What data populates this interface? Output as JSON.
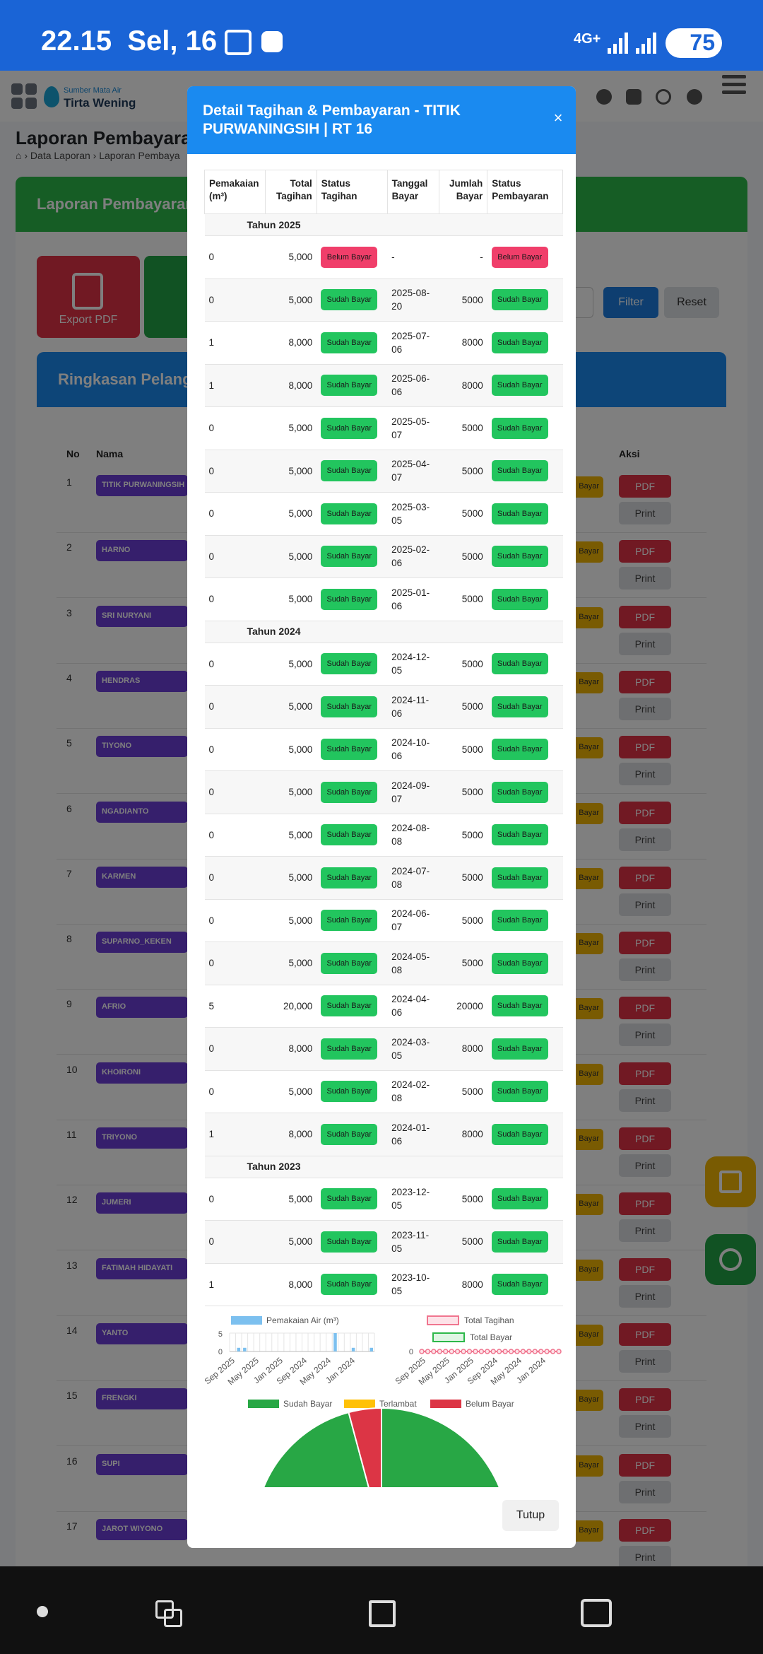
{
  "status_bar": {
    "time": "22.15",
    "date": "Sel, 16",
    "network": "4G+",
    "battery": "75"
  },
  "app": {
    "logo_small": "Sumber Mata Air",
    "logo_big": "Tirta Wening",
    "page_title": "Laporan Pembayaran",
    "breadcrumb": [
      "Data Laporan",
      "Laporan Pembaya"
    ],
    "card_title": "Laporan Pembayaran",
    "export_pdf": "Export PDF",
    "filter": "Filter",
    "reset": "Reset",
    "summary_title": "Ringkasan Pelangg",
    "table_headers": {
      "no": "No",
      "nama": "Nama",
      "aksi": "Aksi"
    },
    "badge_text": "Bayar",
    "pdf_label": "PDF",
    "print_label": "Print",
    "rows": [
      {
        "no": "1",
        "name": "TITIK PURWANINGSIH"
      },
      {
        "no": "2",
        "name": "HARNO"
      },
      {
        "no": "3",
        "name": "SRI NURYANI"
      },
      {
        "no": "4",
        "name": "HENDRAS"
      },
      {
        "no": "5",
        "name": "TIYONO"
      },
      {
        "no": "6",
        "name": "NGADIANTO"
      },
      {
        "no": "7",
        "name": "KARMEN"
      },
      {
        "no": "8",
        "name": "SUPARNO_KEKEN"
      },
      {
        "no": "9",
        "name": "AFRIO"
      },
      {
        "no": "10",
        "name": "KHOIRONI"
      },
      {
        "no": "11",
        "name": "TRIYONO"
      },
      {
        "no": "12",
        "name": "JUMERI"
      },
      {
        "no": "13",
        "name": "FATIMAH HIDAYATI"
      },
      {
        "no": "14",
        "name": "YANTO"
      },
      {
        "no": "15",
        "name": "FRENGKI"
      },
      {
        "no": "16",
        "name": "SUPI"
      },
      {
        "no": "17",
        "name": "JAROT WIYONO"
      }
    ]
  },
  "modal": {
    "title": "Detail Tagihan & Pembayaran - TITIK PURWANINGSIH | RT 16",
    "close": "×",
    "headers": {
      "pemakaian": "Pemakaian (m³)",
      "total": "Total Tagihan",
      "status_tagihan": "Status Tagihan",
      "tanggal": "Tanggal Bayar",
      "jumlah": "Jumlah Bayar",
      "status_pembayaran": "Status Pembayaran"
    },
    "groups": [
      {
        "year": "Tahun 2025",
        "rows": [
          {
            "usage": "0",
            "total": "5,000",
            "st": "Belum Bayar",
            "date": "-",
            "amount": "-",
            "sp": "Belum Bayar"
          },
          {
            "usage": "0",
            "total": "5,000",
            "st": "Sudah Bayar",
            "date": "2025-08-20",
            "amount": "5000",
            "sp": "Sudah Bayar"
          },
          {
            "usage": "1",
            "total": "8,000",
            "st": "Sudah Bayar",
            "date": "2025-07-06",
            "amount": "8000",
            "sp": "Sudah Bayar"
          },
          {
            "usage": "1",
            "total": "8,000",
            "st": "Sudah Bayar",
            "date": "2025-06-06",
            "amount": "8000",
            "sp": "Sudah Bayar"
          },
          {
            "usage": "0",
            "total": "5,000",
            "st": "Sudah Bayar",
            "date": "2025-05-07",
            "amount": "5000",
            "sp": "Sudah Bayar"
          },
          {
            "usage": "0",
            "total": "5,000",
            "st": "Sudah Bayar",
            "date": "2025-04-07",
            "amount": "5000",
            "sp": "Sudah Bayar"
          },
          {
            "usage": "0",
            "total": "5,000",
            "st": "Sudah Bayar",
            "date": "2025-03-05",
            "amount": "5000",
            "sp": "Sudah Bayar"
          },
          {
            "usage": "0",
            "total": "5,000",
            "st": "Sudah Bayar",
            "date": "2025-02-06",
            "amount": "5000",
            "sp": "Sudah Bayar"
          },
          {
            "usage": "0",
            "total": "5,000",
            "st": "Sudah Bayar",
            "date": "2025-01-06",
            "amount": "5000",
            "sp": "Sudah Bayar"
          }
        ]
      },
      {
        "year": "Tahun 2024",
        "rows": [
          {
            "usage": "0",
            "total": "5,000",
            "st": "Sudah Bayar",
            "date": "2024-12-05",
            "amount": "5000",
            "sp": "Sudah Bayar"
          },
          {
            "usage": "0",
            "total": "5,000",
            "st": "Sudah Bayar",
            "date": "2024-11-06",
            "amount": "5000",
            "sp": "Sudah Bayar"
          },
          {
            "usage": "0",
            "total": "5,000",
            "st": "Sudah Bayar",
            "date": "2024-10-06",
            "amount": "5000",
            "sp": "Sudah Bayar"
          },
          {
            "usage": "0",
            "total": "5,000",
            "st": "Sudah Bayar",
            "date": "2024-09-07",
            "amount": "5000",
            "sp": "Sudah Bayar"
          },
          {
            "usage": "0",
            "total": "5,000",
            "st": "Sudah Bayar",
            "date": "2024-08-08",
            "amount": "5000",
            "sp": "Sudah Bayar"
          },
          {
            "usage": "0",
            "total": "5,000",
            "st": "Sudah Bayar",
            "date": "2024-07-08",
            "amount": "5000",
            "sp": "Sudah Bayar"
          },
          {
            "usage": "0",
            "total": "5,000",
            "st": "Sudah Bayar",
            "date": "2024-06-07",
            "amount": "5000",
            "sp": "Sudah Bayar"
          },
          {
            "usage": "0",
            "total": "5,000",
            "st": "Sudah Bayar",
            "date": "2024-05-08",
            "amount": "5000",
            "sp": "Sudah Bayar"
          },
          {
            "usage": "5",
            "total": "20,000",
            "st": "Sudah Bayar",
            "date": "2024-04-06",
            "amount": "20000",
            "sp": "Sudah Bayar"
          },
          {
            "usage": "0",
            "total": "8,000",
            "st": "Sudah Bayar",
            "date": "2024-03-05",
            "amount": "8000",
            "sp": "Sudah Bayar"
          },
          {
            "usage": "0",
            "total": "5,000",
            "st": "Sudah Bayar",
            "date": "2024-02-08",
            "amount": "5000",
            "sp": "Sudah Bayar"
          },
          {
            "usage": "1",
            "total": "8,000",
            "st": "Sudah Bayar",
            "date": "2024-01-06",
            "amount": "8000",
            "sp": "Sudah Bayar"
          }
        ]
      },
      {
        "year": "Tahun 2023",
        "rows": [
          {
            "usage": "0",
            "total": "5,000",
            "st": "Sudah Bayar",
            "date": "2023-12-05",
            "amount": "5000",
            "sp": "Sudah Bayar"
          },
          {
            "usage": "0",
            "total": "5,000",
            "st": "Sudah Bayar",
            "date": "2023-11-05",
            "amount": "5000",
            "sp": "Sudah Bayar"
          },
          {
            "usage": "1",
            "total": "8,000",
            "st": "Sudah Bayar",
            "date": "2023-10-05",
            "amount": "8000",
            "sp": "Sudah Bayar"
          }
        ]
      }
    ],
    "close_button": "Tutup"
  },
  "colors": {
    "header_blue": "#1a8af0",
    "badge_green": "#22c55e",
    "badge_red": "#f03e6a",
    "bar_blue": "#7cc0ef",
    "line_red": "#f0758f",
    "line_green": "#2db84a",
    "pie_green": "#28a745",
    "pie_yellow": "#ffc107",
    "pie_red": "#dc3545"
  },
  "chart_data": [
    {
      "type": "bar",
      "legend": "Pemakaian Air (m³)",
      "yticks": [
        "5",
        "0"
      ],
      "xticks": [
        "Sep 2025",
        "May 2025",
        "Jan 2025",
        "Sep 2024",
        "May 2024",
        "Jan 2024"
      ],
      "values": [
        0,
        1,
        1,
        0,
        0,
        0,
        0,
        0,
        0,
        0,
        0,
        0,
        0,
        0,
        0,
        0,
        0,
        5,
        0,
        0,
        1,
        0,
        0,
        1
      ],
      "ylim": [
        0,
        5
      ]
    },
    {
      "type": "line",
      "series": [
        {
          "name": "Total Tagihan",
          "values": [
            0,
            0,
            0,
            0,
            0,
            0,
            0,
            0,
            0,
            0,
            0,
            0,
            0,
            0,
            0,
            0,
            0,
            0,
            0,
            0,
            0,
            0,
            0,
            0
          ]
        },
        {
          "name": "Total Bayar",
          "values": [
            0,
            0,
            0,
            0,
            0,
            0,
            0,
            0,
            0,
            0,
            0,
            0,
            0,
            0,
            0,
            0,
            0,
            0,
            0,
            0,
            0,
            0,
            0,
            0
          ]
        }
      ],
      "yticks": [
        "0"
      ],
      "xticks": [
        "Sep 2025",
        "May 2025",
        "Jan 2025",
        "Sep 2024",
        "May 2024",
        "Jan 2024"
      ]
    },
    {
      "type": "pie",
      "legend": [
        "Sudah Bayar",
        "Terlambat",
        "Belum Bayar"
      ],
      "values": [
        23,
        0,
        1
      ]
    }
  ]
}
